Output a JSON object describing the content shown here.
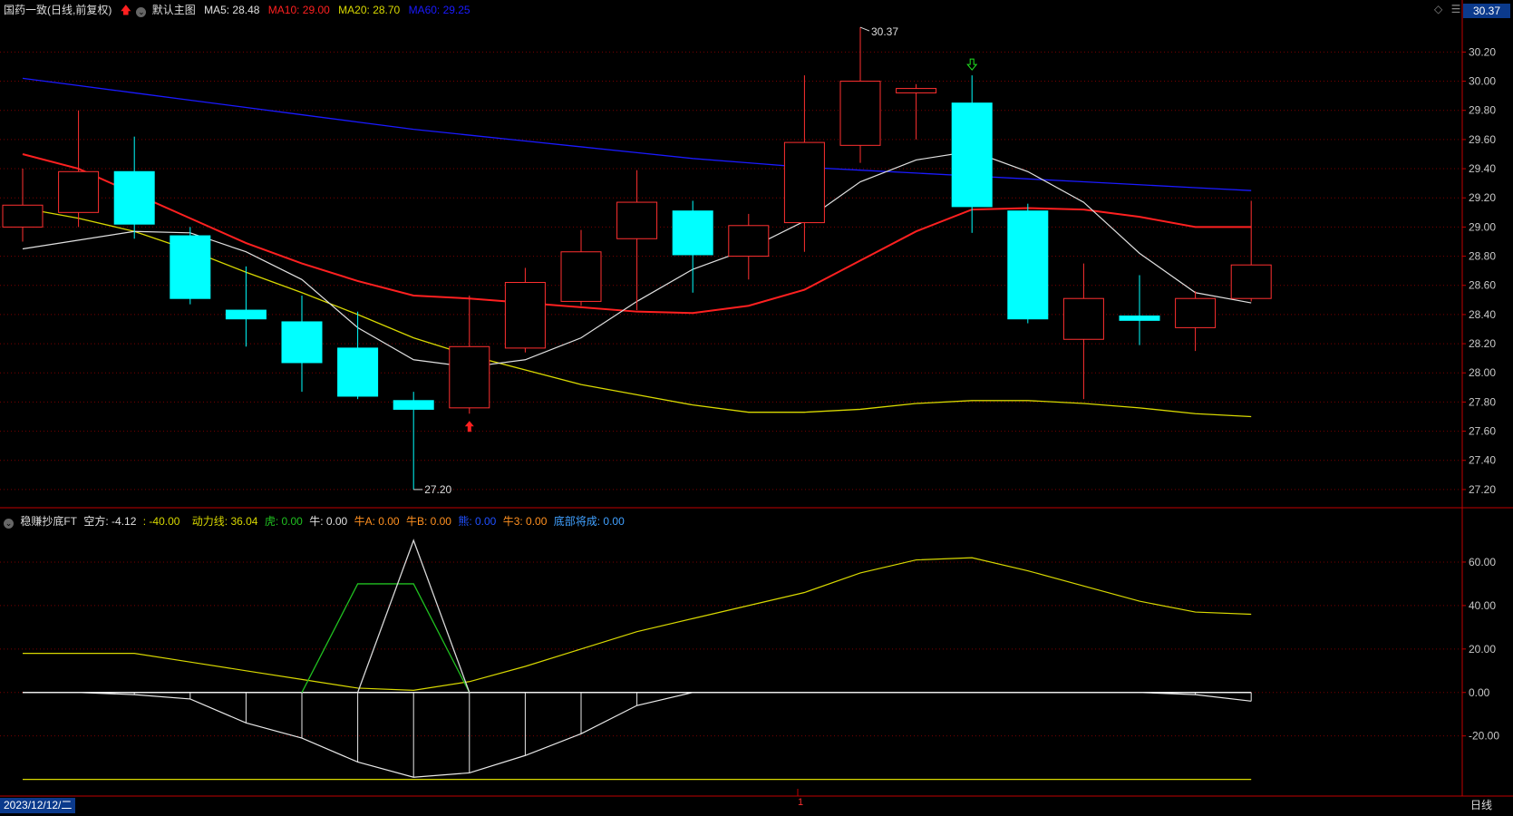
{
  "header": {
    "stock_title": "国药一致(日线,前复权)",
    "template_label": "默认主图",
    "ma5": "MA5: 28.48",
    "ma10": "MA10: 29.00",
    "ma20": "MA20: 28.70",
    "ma60": "MA60: 29.25",
    "up_arrow_color": "#ff2020"
  },
  "current_price_badge": "30.37",
  "indicator_header": {
    "name": "稳赚抄底FT",
    "kongfang": "空方: -4.12",
    "kongfang2": ": -40.00",
    "dongli": "动力线: 36.04",
    "hu": "虎: 0.00",
    "niu": "牛: 0.00",
    "niuA": "牛A: 0.00",
    "niuB": "牛B: 0.00",
    "xiong": "熊: 0.00",
    "niu3": "牛3: 0.00",
    "dibu": "底部将成: 0.00"
  },
  "footer": {
    "date": "2023/12/12/二",
    "period": "日线",
    "cursor_label": "1"
  },
  "colors": {
    "up": "#ff3030",
    "down": "#00ffff",
    "ma5": "#e0e0e0",
    "ma10": "#ff2020",
    "ma20": "#d8d800",
    "ma60": "#1a1aff",
    "axis": "#c00000",
    "grid": "#7a0000"
  },
  "chart_data": [
    {
      "type": "candlestick",
      "title": "国药一致(日线,前复权)",
      "y_ticks": [
        "30.20",
        "30.00",
        "29.80",
        "29.60",
        "29.40",
        "29.20",
        "29.00",
        "28.80",
        "28.60",
        "28.40",
        "28.20",
        "28.00",
        "27.80",
        "27.60",
        "27.40",
        "27.20"
      ],
      "ylim": [
        27.1,
        30.42
      ],
      "candles": [
        {
          "open": 29.0,
          "close": 29.15,
          "high": 29.4,
          "low": 28.9
        },
        {
          "open": 29.1,
          "close": 29.38,
          "high": 29.8,
          "low": 29.0
        },
        {
          "open": 29.38,
          "close": 29.02,
          "high": 29.62,
          "low": 28.92
        },
        {
          "open": 28.94,
          "close": 28.51,
          "high": 29.0,
          "low": 28.47
        },
        {
          "open": 28.43,
          "close": 28.37,
          "high": 28.73,
          "low": 28.18
        },
        {
          "open": 28.35,
          "close": 28.07,
          "high": 28.53,
          "low": 27.87
        },
        {
          "open": 28.17,
          "close": 27.84,
          "high": 28.42,
          "low": 27.82
        },
        {
          "open": 27.81,
          "close": 27.75,
          "high": 27.87,
          "low": 27.2
        },
        {
          "open": 27.76,
          "close": 28.18,
          "high": 28.53,
          "low": 27.72
        },
        {
          "open": 28.17,
          "close": 28.62,
          "high": 28.72,
          "low": 28.14
        },
        {
          "open": 28.49,
          "close": 28.83,
          "high": 28.98,
          "low": 28.46
        },
        {
          "open": 28.92,
          "close": 29.17,
          "high": 29.39,
          "low": 28.43
        },
        {
          "open": 29.11,
          "close": 28.81,
          "high": 29.18,
          "low": 28.55
        },
        {
          "open": 28.8,
          "close": 29.01,
          "high": 29.09,
          "low": 28.64
        },
        {
          "open": 29.03,
          "close": 29.58,
          "high": 30.04,
          "low": 28.83
        },
        {
          "open": 29.56,
          "close": 30.0,
          "high": 30.37,
          "low": 29.44
        },
        {
          "open": 29.92,
          "close": 29.95,
          "high": 29.98,
          "low": 29.6
        },
        {
          "open": 29.85,
          "close": 29.14,
          "high": 30.04,
          "low": 28.96
        },
        {
          "open": 29.11,
          "close": 28.37,
          "high": 29.16,
          "low": 28.34
        },
        {
          "open": 28.23,
          "close": 28.51,
          "high": 28.75,
          "low": 27.82
        },
        {
          "open": 28.39,
          "close": 28.36,
          "high": 28.67,
          "low": 28.19
        },
        {
          "open": 28.31,
          "close": 28.51,
          "high": 28.56,
          "low": 28.15
        },
        {
          "open": 28.51,
          "close": 28.74,
          "high": 29.18,
          "low": 28.49
        }
      ],
      "ma5": [
        28.85,
        28.91,
        28.97,
        28.96,
        28.83,
        28.64,
        28.31,
        28.09,
        28.04,
        28.09,
        28.24,
        28.49,
        28.71,
        28.85,
        29.04,
        29.31,
        29.46,
        29.52,
        29.38,
        29.17,
        28.82,
        28.55,
        28.48
      ],
      "ma10": [
        29.5,
        29.4,
        29.23,
        29.06,
        28.89,
        28.75,
        28.63,
        28.53,
        28.51,
        28.48,
        28.45,
        28.42,
        28.41,
        28.46,
        28.57,
        28.77,
        28.97,
        29.12,
        29.13,
        29.12,
        29.07,
        29.0,
        29.0
      ],
      "ma20": [
        29.13,
        29.06,
        28.97,
        28.84,
        28.69,
        28.55,
        28.4,
        28.24,
        28.12,
        28.02,
        27.92,
        27.85,
        27.78,
        27.73,
        27.73,
        27.75,
        27.79,
        27.81,
        27.81,
        27.79,
        27.76,
        27.72,
        27.7
      ],
      "ma60": [
        30.02,
        29.97,
        29.92,
        29.87,
        29.82,
        29.77,
        29.72,
        29.67,
        29.63,
        29.59,
        29.55,
        29.51,
        29.47,
        29.44,
        29.41,
        29.39,
        29.37,
        29.35,
        29.33,
        29.31,
        29.29,
        29.27,
        29.25
      ],
      "annotations": [
        {
          "label": "30.37",
          "candle": 15,
          "price": 30.37,
          "kind": "high"
        },
        {
          "label": "27.20",
          "candle": 7,
          "price": 27.2,
          "kind": "low"
        }
      ],
      "signals": [
        {
          "candle": 8,
          "kind": "buy-arrow"
        },
        {
          "candle": 17,
          "kind": "sell-arrow"
        }
      ]
    },
    {
      "type": "line",
      "title": "稳赚抄底FT",
      "y_ticks": [
        "60.00",
        "40.00",
        "20.00",
        "0.00",
        "-20.00"
      ],
      "ylim": [
        -46,
        75
      ],
      "dongli": [
        18,
        18,
        18,
        14,
        10,
        6,
        2,
        1,
        5,
        12,
        20,
        28,
        34,
        40,
        46,
        55,
        61,
        62,
        56,
        49,
        42,
        37,
        36
      ],
      "kongfang": [
        0,
        0,
        -1,
        -3,
        -14,
        -21,
        -32,
        -39,
        -37,
        -29,
        -19,
        -6,
        0,
        0,
        0,
        0,
        0,
        0,
        0,
        0,
        0,
        -1,
        -4
      ],
      "kongfang_base": -40,
      "hu": [
        null,
        null,
        null,
        null,
        null,
        0,
        50,
        50,
        0,
        null,
        null,
        null,
        null,
        null,
        null,
        null,
        null,
        null,
        null,
        null,
        null,
        null,
        null
      ],
      "white_peak": [
        null,
        null,
        null,
        null,
        null,
        null,
        0,
        70,
        0,
        null,
        null,
        null,
        null,
        null,
        null,
        null,
        null,
        null,
        null,
        null,
        null,
        null,
        null
      ]
    }
  ]
}
